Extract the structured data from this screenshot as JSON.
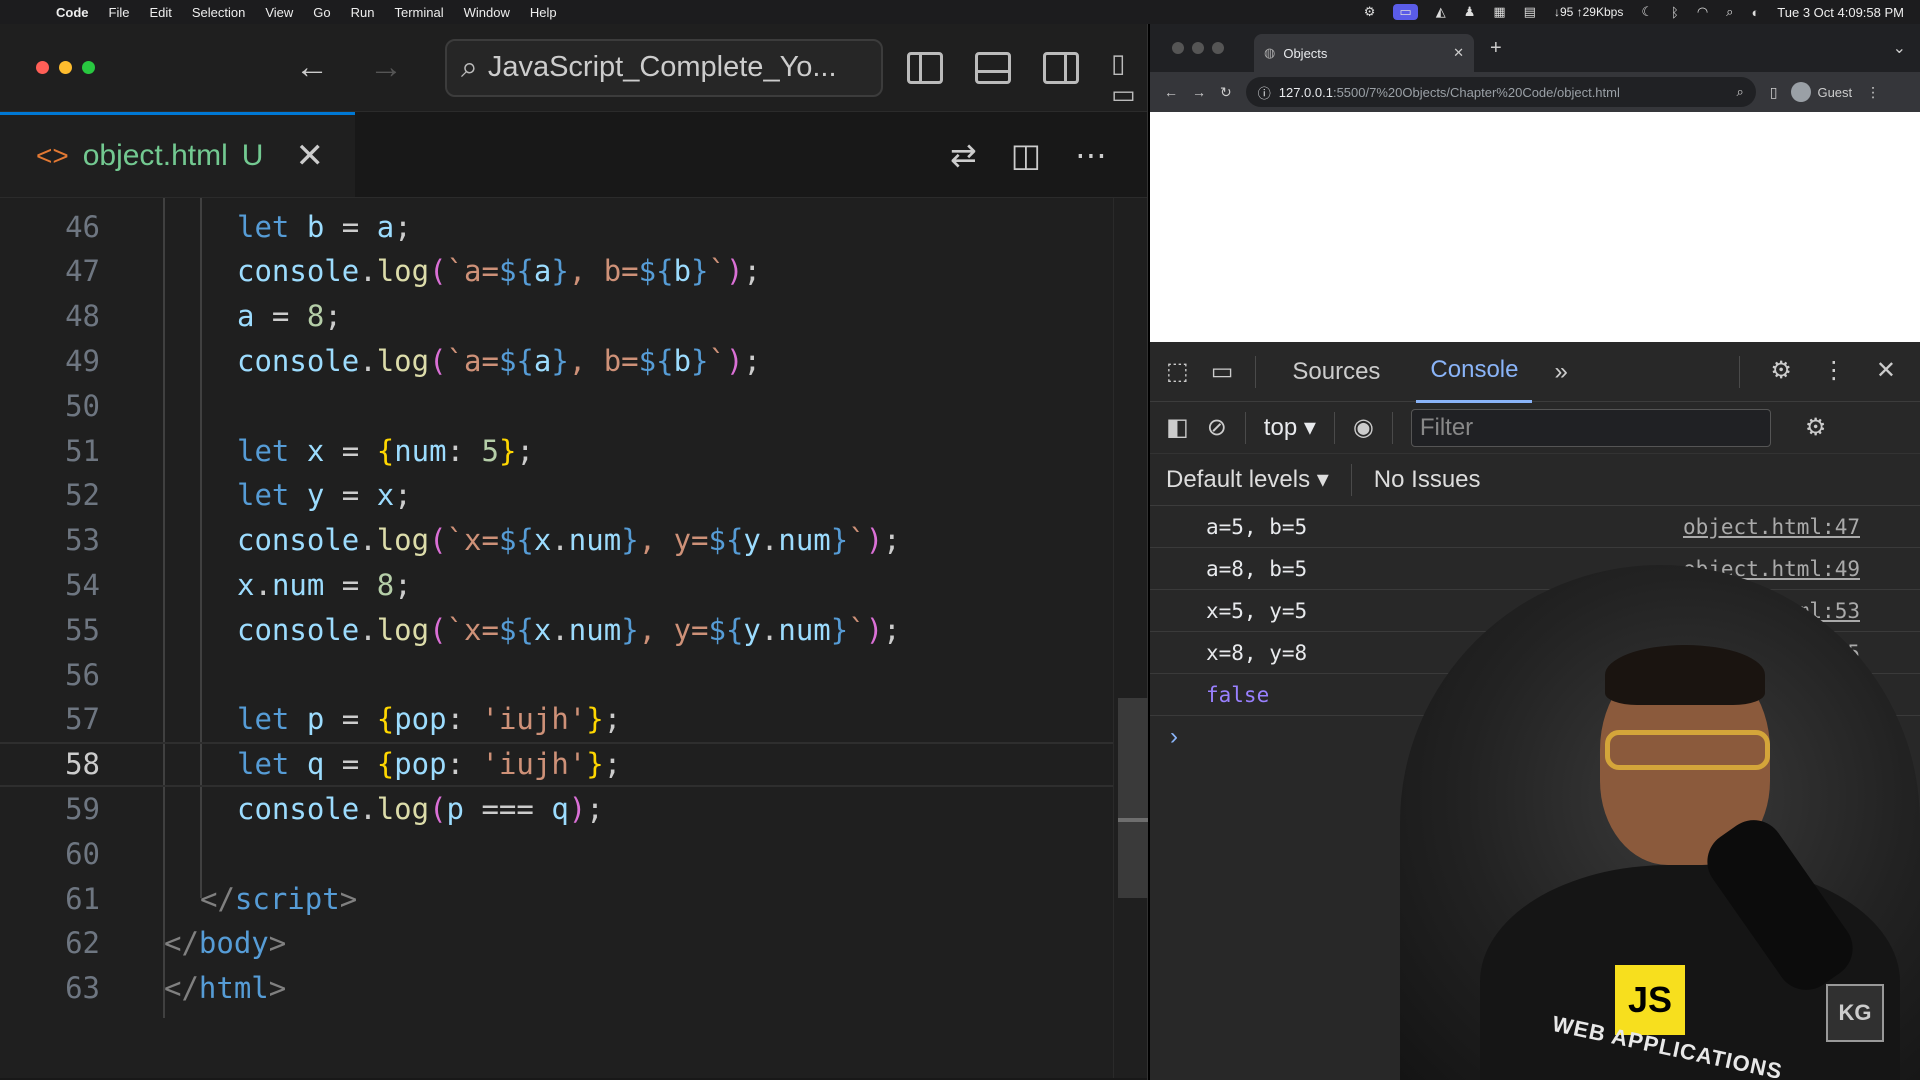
{
  "menubar": {
    "app": "Code",
    "items": [
      "File",
      "Edit",
      "Selection",
      "View",
      "Go",
      "Run",
      "Terminal",
      "Window",
      "Help"
    ],
    "network": "↓95 ↑29Kbps",
    "clock": "Tue 3 Oct  4:09:58 PM"
  },
  "vscode": {
    "command_center": "JavaScript_Complete_Yo...",
    "tab": {
      "label": "object.html",
      "status": "U"
    },
    "current_line": 58,
    "lines": [
      {
        "n": "46",
        "html": "<span class='kw'>let</span> <span class='var'>b</span> = <span class='var'>a</span>;"
      },
      {
        "n": "47",
        "html": "<span class='var'>console</span>.<span class='fn'>log</span><span class='br2'>(</span><span class='str'>`a=</span><span class='tmpl'>${</span><span class='var'>a</span><span class='tmpl'>}</span><span class='str'>, b=</span><span class='tmpl'>${</span><span class='var'>b</span><span class='tmpl'>}</span><span class='str'>`</span><span class='br2'>)</span>;"
      },
      {
        "n": "48",
        "html": "<span class='var'>a</span> = <span class='num'>8</span>;"
      },
      {
        "n": "49",
        "html": "<span class='var'>console</span>.<span class='fn'>log</span><span class='br2'>(</span><span class='str'>`a=</span><span class='tmpl'>${</span><span class='var'>a</span><span class='tmpl'>}</span><span class='str'>, b=</span><span class='tmpl'>${</span><span class='var'>b</span><span class='tmpl'>}</span><span class='str'>`</span><span class='br2'>)</span>;"
      },
      {
        "n": "50",
        "html": ""
      },
      {
        "n": "51",
        "html": "<span class='kw'>let</span> <span class='var'>x</span> = <span class='br1'>{</span><span class='var'>num</span>: <span class='num'>5</span><span class='br1'>}</span>;"
      },
      {
        "n": "52",
        "html": "<span class='kw'>let</span> <span class='var'>y</span> = <span class='var'>x</span>;"
      },
      {
        "n": "53",
        "html": "<span class='var'>console</span>.<span class='fn'>log</span><span class='br2'>(</span><span class='str'>`x=</span><span class='tmpl'>${</span><span class='var'>x</span>.<span class='var'>num</span><span class='tmpl'>}</span><span class='str'>, y=</span><span class='tmpl'>${</span><span class='var'>y</span>.<span class='var'>num</span><span class='tmpl'>}</span><span class='str'>`</span><span class='br2'>)</span>;"
      },
      {
        "n": "54",
        "html": "<span class='var'>x</span>.<span class='var'>num</span> = <span class='num'>8</span>;"
      },
      {
        "n": "55",
        "html": "<span class='var'>console</span>.<span class='fn'>log</span><span class='br2'>(</span><span class='str'>`x=</span><span class='tmpl'>${</span><span class='var'>x</span>.<span class='var'>num</span><span class='tmpl'>}</span><span class='str'>, y=</span><span class='tmpl'>${</span><span class='var'>y</span>.<span class='var'>num</span><span class='tmpl'>}</span><span class='str'>`</span><span class='br2'>)</span>;"
      },
      {
        "n": "56",
        "html": ""
      },
      {
        "n": "57",
        "html": "<span class='kw'>let</span> <span class='var'>p</span> = <span class='br1'>{</span><span class='var'>pop</span>: <span class='str'>'iujh'</span><span class='br1'>}</span>;"
      },
      {
        "n": "58",
        "html": "<span class='kw'>let</span> <span class='var'>q</span> = <span class='br1'>{</span><span class='var'>pop</span>: <span class='str'>'iujh'</span><span class='br1'>}</span>;"
      },
      {
        "n": "59",
        "html": "<span class='var'>console</span>.<span class='fn'>log</span><span class='br2'>(</span><span class='var'>p</span> === <span class='var'>q</span><span class='br2'>)</span>;"
      },
      {
        "n": "60",
        "html": ""
      },
      {
        "n": "61",
        "html": "<span class='punc'>&lt;/</span><span class='tag'>script</span><span class='punc'>&gt;</span>"
      },
      {
        "n": "62",
        "html": "<span class='punc'>&lt;/</span><span class='tag'>body</span><span class='punc'>&gt;</span>"
      },
      {
        "n": "63",
        "html": "<span class='punc'>&lt;/</span><span class='tag'>html</span><span class='punc'>&gt;</span>"
      }
    ]
  },
  "chrome": {
    "tab_title": "Objects",
    "url": "127.0.0.1:5500/7%20Objects/Chapter%20Code/object.html",
    "url_host": "127.0.0.1",
    "url_path": ":5500/7%20Objects/Chapter%20Code/object.html",
    "profile": "Guest"
  },
  "devtools": {
    "tabs": [
      "Sources",
      "Console"
    ],
    "active_tab": "Console",
    "context": "top",
    "filter_placeholder": "Filter",
    "levels": "Default levels",
    "issues": "No Issues",
    "logs": [
      {
        "msg": "a=5, b=5",
        "src": "object.html:47"
      },
      {
        "msg": "a=8, b=5",
        "src": "object.html:49"
      },
      {
        "msg": "x=5, y=5",
        "src": "object.html:53"
      },
      {
        "msg": "x=8, y=8",
        "src": "object.html:55"
      },
      {
        "msg": "false",
        "src": ""
      }
    ]
  },
  "overlay": {
    "shirt_badge": "JS",
    "shirt_text": "WEB APPLICATIONS",
    "logo": "KG"
  }
}
